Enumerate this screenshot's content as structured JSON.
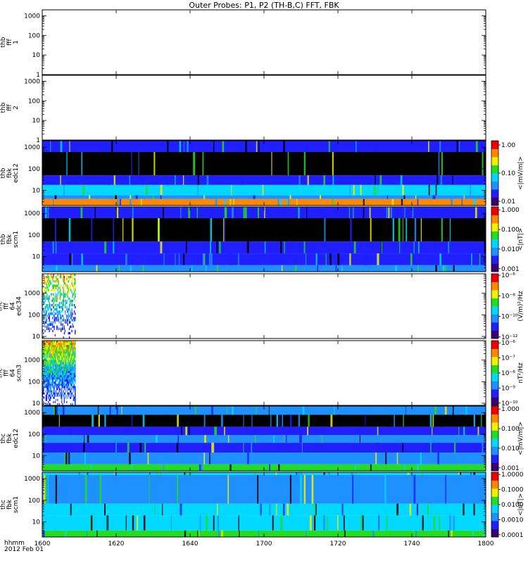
{
  "title": "Outer Probes: P1, P2 (TH-B,C) FFT, FBK",
  "time_axis": {
    "label": "hhmm",
    "date": "2012 Feb 01",
    "range": [
      1600,
      1800
    ],
    "ticks": [
      {
        "value": 1600,
        "label": "1600"
      },
      {
        "value": 1620,
        "label": "1620"
      },
      {
        "value": 1640,
        "label": "1640"
      },
      {
        "value": 1700,
        "label": "1700"
      },
      {
        "value": 1720,
        "label": "1720"
      },
      {
        "value": 1740,
        "label": "1740"
      },
      {
        "value": 1800,
        "label": "1800"
      }
    ]
  },
  "colors": {
    "black": "#000000",
    "blue": "#1f1fff",
    "azure": "#1e90ff",
    "cyan": "#00d8ff",
    "green": "#22dd22",
    "yellow": "#f0f000",
    "orange": "#ff8800",
    "red": "#ee0000"
  },
  "chart_data": [
    {
      "type": "heatmap",
      "label": [
        "thb",
        "fff",
        "1"
      ],
      "y_scale": "log",
      "ylim": [
        1,
        2000
      ],
      "y_ticks": [
        "1",
        "10",
        "100",
        "1000"
      ],
      "colorbar": null,
      "content": "empty"
    },
    {
      "type": "heatmap",
      "label": [
        "thb",
        "fff",
        "2"
      ],
      "y_scale": "log",
      "ylim": [
        1,
        2000
      ],
      "y_ticks": [
        "1",
        "10",
        "100",
        "1000"
      ],
      "colorbar": null,
      "content": "empty"
    },
    {
      "type": "heatmap",
      "label": [
        "thb",
        "fbk",
        "edc12"
      ],
      "y_scale": "log",
      "ylim": [
        2,
        2000
      ],
      "y_ticks": [
        "10",
        "100",
        "1000"
      ],
      "colorbar": {
        "label": "<|mV/m|>",
        "ticks": [
          "1.00",
          "0.10",
          "0.01"
        ],
        "scale": "log"
      },
      "data_coverage": [
        1600,
        1800
      ],
      "bands": [
        {
          "range": [
            2,
            4
          ],
          "color": "orange"
        },
        {
          "range": [
            4,
            6
          ],
          "color": "azure"
        },
        {
          "range": [
            6,
            18
          ],
          "color": "cyan"
        },
        {
          "range": [
            18,
            50
          ],
          "color": "blue"
        },
        {
          "range": [
            50,
            600
          ],
          "color": "black"
        },
        {
          "range": [
            600,
            2000
          ],
          "color": "blue"
        }
      ]
    },
    {
      "type": "heatmap",
      "label": [
        "thb",
        "fbk",
        "scm1"
      ],
      "y_scale": "log",
      "ylim": [
        2,
        2000
      ],
      "y_ticks": [
        "10",
        "100",
        "1000"
      ],
      "colorbar": {
        "label": "<|nT|>",
        "ticks": [
          "1.000",
          "0.100",
          "0.010",
          "0.001"
        ],
        "scale": "log"
      },
      "data_coverage": [
        1600,
        1800
      ],
      "bands": [
        {
          "range": [
            2,
            4
          ],
          "color": "azure"
        },
        {
          "range": [
            4,
            14
          ],
          "color": "blue"
        },
        {
          "range": [
            14,
            50
          ],
          "color": "blue"
        },
        {
          "range": [
            50,
            600
          ],
          "color": "black"
        },
        {
          "range": [
            600,
            2000
          ],
          "color": "blue"
        }
      ]
    },
    {
      "type": "heatmap",
      "label": [
        "thc",
        "fff",
        "64",
        "edc34"
      ],
      "y_scale": "log",
      "ylim": [
        8,
        8000
      ],
      "y_ticks": [
        "10",
        "100",
        "1000"
      ],
      "colorbar": {
        "label": "(V/m)²/Hz",
        "ticks": [
          "10⁻⁶",
          "10⁻⁸",
          "10⁻¹⁰",
          "10⁻¹²"
        ],
        "scale": "log"
      },
      "data_coverage": [
        1600,
        1609
      ]
    },
    {
      "type": "heatmap",
      "label": [
        "thc",
        "fff",
        "64",
        "scm3"
      ],
      "y_scale": "log",
      "ylim": [
        8,
        8000
      ],
      "y_ticks": [
        "10",
        "100",
        "1000"
      ],
      "colorbar": {
        "label": "nT²/Hz",
        "ticks": [
          "10⁻⁶",
          "10⁻⁷",
          "10⁻⁸",
          "10⁻⁹",
          "10⁻¹⁰"
        ],
        "scale": "log"
      },
      "data_coverage": [
        1600,
        1609
      ]
    },
    {
      "type": "heatmap",
      "label": [
        "thc",
        "fbk",
        "edc12"
      ],
      "y_scale": "log",
      "ylim": [
        2,
        2000
      ],
      "y_ticks": [
        "10",
        "100",
        "1000"
      ],
      "colorbar": {
        "label": "<|mV/m|>",
        "ticks": [
          "1.000",
          "0.100",
          "0.010",
          "0.001"
        ],
        "scale": "log"
      },
      "data_coverage": [
        1600,
        1800
      ],
      "bands": [
        {
          "range": [
            2,
            4
          ],
          "color": "green"
        },
        {
          "range": [
            4,
            14
          ],
          "color": "azure"
        },
        {
          "range": [
            14,
            40
          ],
          "color": "blue"
        },
        {
          "range": [
            40,
            90
          ],
          "color": "azure"
        },
        {
          "range": [
            90,
            220
          ],
          "color": "blue"
        },
        {
          "range": [
            220,
            800
          ],
          "color": "black"
        },
        {
          "range": [
            800,
            2000
          ],
          "color": "azure"
        }
      ]
    },
    {
      "type": "heatmap",
      "label": [
        "thc",
        "fbk",
        "scm1"
      ],
      "y_scale": "log",
      "ylim": [
        2,
        2000
      ],
      "y_ticks": [
        "10",
        "100",
        "1000"
      ],
      "colorbar": {
        "label": "<|nT|>",
        "ticks": [
          "1.0000",
          "0.1000",
          "0.0100",
          "0.0010",
          "0.0001"
        ],
        "scale": "log"
      },
      "data_coverage": [
        1600,
        1800
      ],
      "bands": [
        {
          "range": [
            2,
            4
          ],
          "color": "green"
        },
        {
          "range": [
            4,
            20
          ],
          "color": "cyan"
        },
        {
          "range": [
            20,
            70
          ],
          "color": "cyan"
        },
        {
          "range": [
            70,
            1500
          ],
          "color": "azure"
        },
        {
          "range": [
            1500,
            2000
          ],
          "color": "cyan"
        }
      ]
    }
  ]
}
